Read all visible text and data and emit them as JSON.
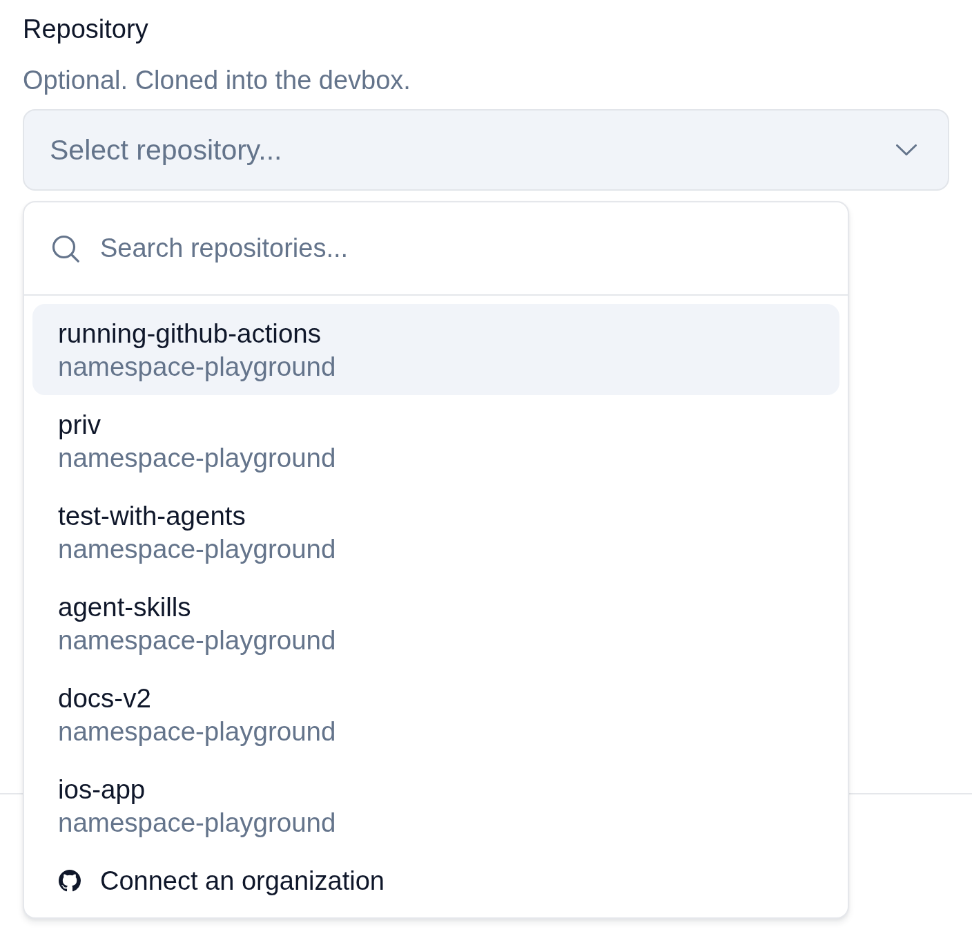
{
  "field": {
    "label": "Repository",
    "description": "Optional. Cloned into the devbox.",
    "select": {
      "placeholder": "Select repository...",
      "expanded": true
    }
  },
  "dropdown": {
    "search": {
      "placeholder": "Search repositories..."
    },
    "options": [
      {
        "name": "running-github-actions",
        "owner": "namespace-playground",
        "selected": true
      },
      {
        "name": "priv",
        "owner": "namespace-playground",
        "selected": false
      },
      {
        "name": "test-with-agents",
        "owner": "namespace-playground",
        "selected": false
      },
      {
        "name": "agent-skills",
        "owner": "namespace-playground",
        "selected": false
      },
      {
        "name": "docs-v2",
        "owner": "namespace-playground",
        "selected": false
      },
      {
        "name": "ios-app",
        "owner": "namespace-playground",
        "selected": false
      }
    ],
    "footer_action": {
      "label": "Connect an organization"
    }
  }
}
